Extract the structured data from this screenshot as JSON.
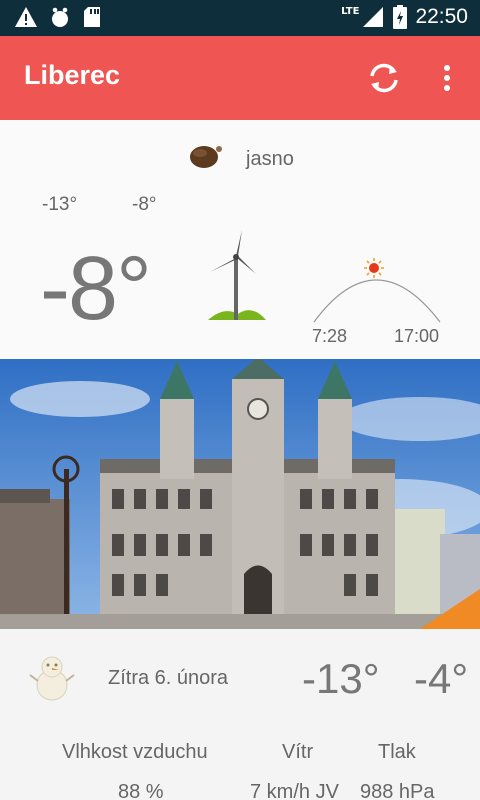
{
  "status_bar": {
    "icons": [
      "warning-icon",
      "bug-icon",
      "sd-card-icon"
    ],
    "network": "LTE",
    "time": "22:50"
  },
  "app_bar": {
    "title": "Liberec",
    "actions": [
      "refresh-icon",
      "more-vert-icon"
    ],
    "color": "#ee5553"
  },
  "current": {
    "condition_icon": "clear-night-moon-icon",
    "condition": "jasno",
    "temp_min": "-13°",
    "temp_max": "-8°",
    "temp_now": "-8°",
    "wind_icon": "wind-turbine-icon",
    "sun_icon": "sun-arc-icon",
    "sunrise": "7:28",
    "sunset": "17:00"
  },
  "photo": {
    "subject": "city-hall-photo"
  },
  "forecast": {
    "icon": "snowman-icon",
    "day": "Zítra 6. února",
    "temp_min": "-13°",
    "temp_max": "-4°",
    "labels": {
      "humidity": "Vlhkost vzduchu",
      "wind": "Vítr",
      "pressure": "Tlak"
    },
    "values": {
      "humidity": "88 %",
      "wind": "7 km/h JV",
      "pressure": "988 hPa"
    }
  }
}
